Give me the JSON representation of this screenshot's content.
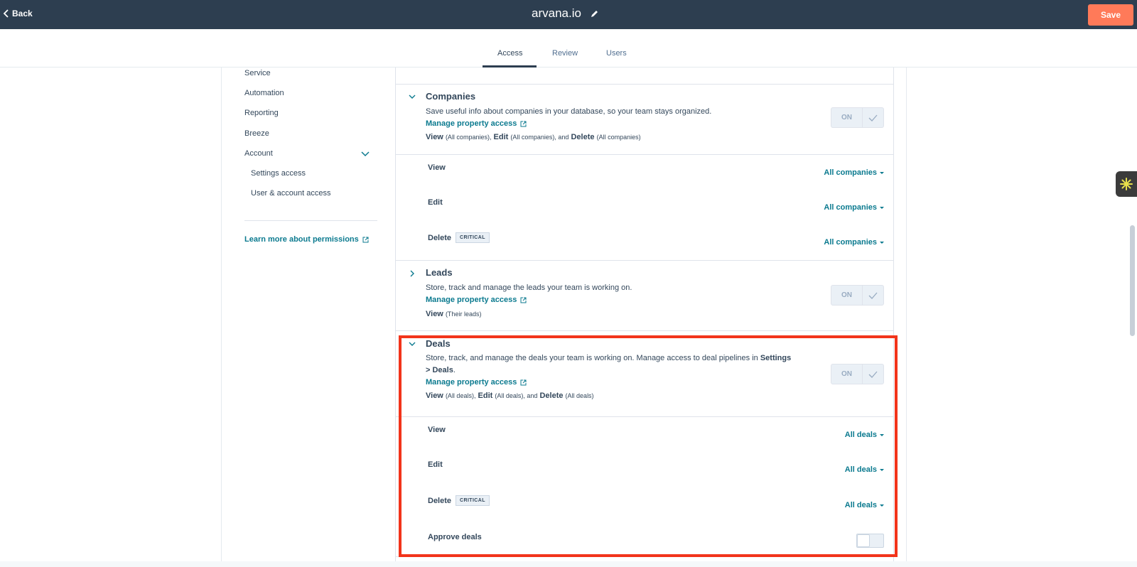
{
  "topbar": {
    "back_label": "Back",
    "title": "arvana.io",
    "save_label": "Save",
    "accent_color": "#ff7a59",
    "bg_color": "#2d3e50"
  },
  "tabs": [
    {
      "label": "Access",
      "active": true
    },
    {
      "label": "Review",
      "active": false
    },
    {
      "label": "Users",
      "active": false
    }
  ],
  "sidebar": {
    "items": [
      {
        "label": "Service"
      },
      {
        "label": "Automation"
      },
      {
        "label": "Reporting"
      },
      {
        "label": "Breeze"
      },
      {
        "label": "Account",
        "expanded": true
      }
    ],
    "subitems": [
      {
        "label": "Settings access"
      },
      {
        "label": "User & account access"
      }
    ],
    "learn_link": "Learn more about permissions"
  },
  "sections": {
    "companies": {
      "title": "Companies",
      "description": "Save useful info about companies in your database, so your team stays organized.",
      "manage_link": "Manage property access",
      "summary": {
        "view": "View",
        "view_scope": "(All companies),",
        "edit": "Edit",
        "edit_scope": "(All companies), and",
        "delete": "Delete",
        "delete_scope": "(All companies)"
      },
      "on_label": "ON",
      "rows": [
        {
          "label": "View",
          "value": "All companies"
        },
        {
          "label": "Edit",
          "value": "All companies"
        },
        {
          "label": "Delete",
          "badge": "CRITICAL",
          "value": "All companies"
        }
      ]
    },
    "leads": {
      "title": "Leads",
      "description": "Store, track and manage the leads your team is working on.",
      "manage_link": "Manage property access",
      "summary": {
        "view": "View",
        "view_scope": "(Their leads)"
      },
      "on_label": "ON"
    },
    "deals": {
      "title": "Deals",
      "description": "Store, track, and manage the deals your team is working on. Manage access to deal pipelines in",
      "description_link": "Settings > Deals",
      "description_end": ".",
      "manage_link": "Manage property access",
      "summary": {
        "view": "View",
        "view_scope": "(All deals),",
        "edit": "Edit",
        "edit_scope": "(All deals), and",
        "delete": "Delete",
        "delete_scope": "(All deals)"
      },
      "on_label": "ON",
      "rows": [
        {
          "label": "View",
          "value": "All deals"
        },
        {
          "label": "Edit",
          "value": "All deals"
        },
        {
          "label": "Delete",
          "badge": "CRITICAL",
          "value": "All deals"
        }
      ],
      "approve_label": "Approve deals",
      "approve_on": false
    }
  },
  "highlight_color": "#f2341b"
}
